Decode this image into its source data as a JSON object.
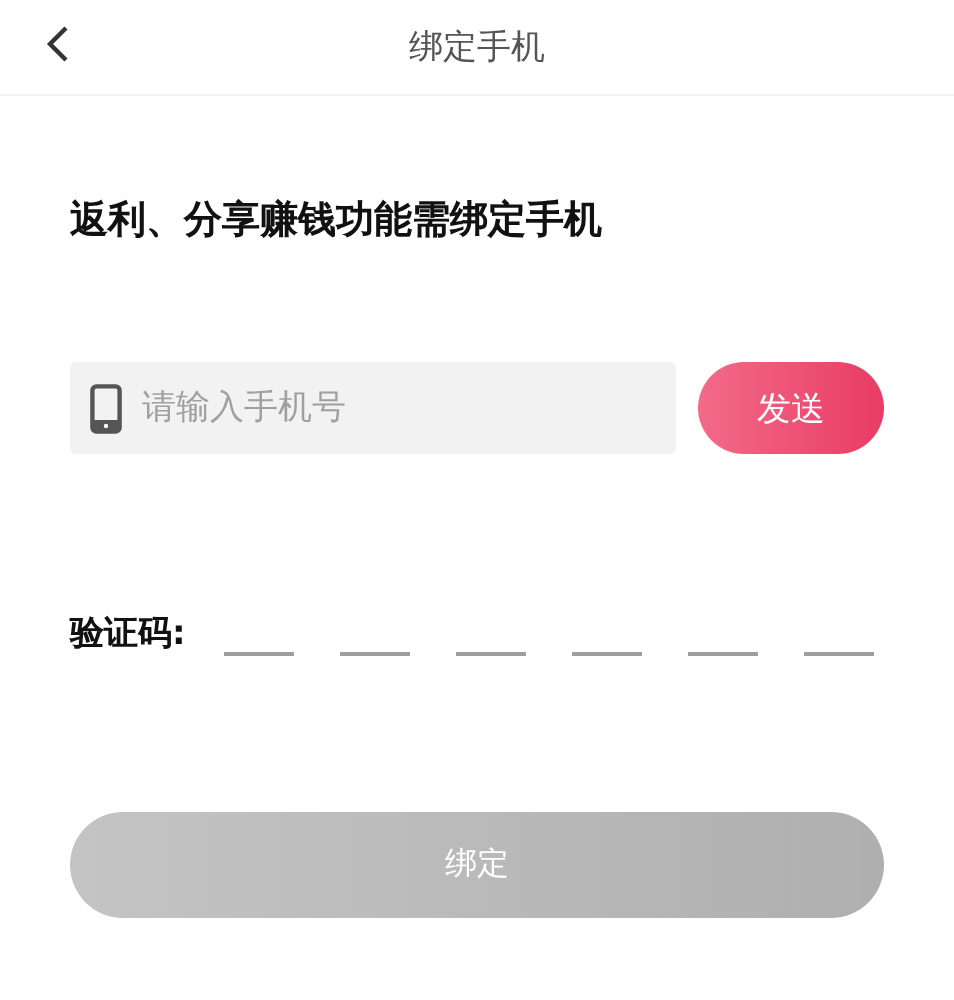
{
  "header": {
    "title": "绑定手机"
  },
  "prompt": "返利、分享赚钱功能需绑定手机",
  "phone_field": {
    "placeholder": "请输入手机号"
  },
  "send_button": {
    "label": "发送",
    "disabled": false
  },
  "code": {
    "label": "验证码:",
    "slots": [
      {
        "kind": "blank"
      },
      {
        "kind": "blank"
      },
      {
        "kind": "blank"
      },
      {
        "kind": "blank"
      },
      {
        "kind": "blank"
      },
      {
        "kind": "blank"
      }
    ]
  },
  "bind_button": {
    "label": "绑定",
    "disabled": true
  }
}
